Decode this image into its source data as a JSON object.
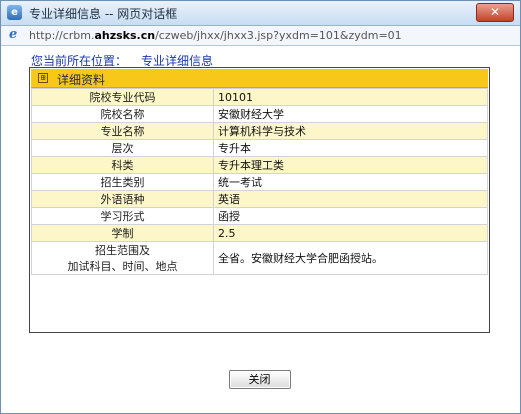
{
  "window": {
    "title": "专业详细信息 -- 网页对话框",
    "close_symbol": "✕"
  },
  "address": {
    "prefix": "http://crbm.",
    "domain": "ahzsks.cn",
    "path": "/czweb/jhxx/jhxx3.jsp?yxdm=101&zydm=01"
  },
  "location": {
    "label": "您当前所在位置：",
    "current": "专业详细信息"
  },
  "panel": {
    "header": "详细资料",
    "rows": [
      {
        "label": "院校专业代码",
        "value": "10101",
        "style": "y"
      },
      {
        "label": "院校名称",
        "value": "安徽财经大学",
        "style": "w"
      },
      {
        "label": "专业名称",
        "value": "计算机科学与技术",
        "style": "y"
      },
      {
        "label": "层次",
        "value": "专升本",
        "style": "w"
      },
      {
        "label": "科类",
        "value": "专升本理工类",
        "style": "y"
      },
      {
        "label": "招生类别",
        "value": "统一考试",
        "style": "w"
      },
      {
        "label": "外语语种",
        "value": "英语",
        "style": "y"
      },
      {
        "label": "学习形式",
        "value": "函授",
        "style": "w"
      },
      {
        "label": "学制",
        "value": "2.5",
        "style": "y"
      },
      {
        "label_line1": "招生范围及",
        "label_line2": "加试科目、时间、地点",
        "value": "全省。安徽财经大学合肥函授站。",
        "style": "w"
      }
    ]
  },
  "buttons": {
    "close": "关闭"
  }
}
